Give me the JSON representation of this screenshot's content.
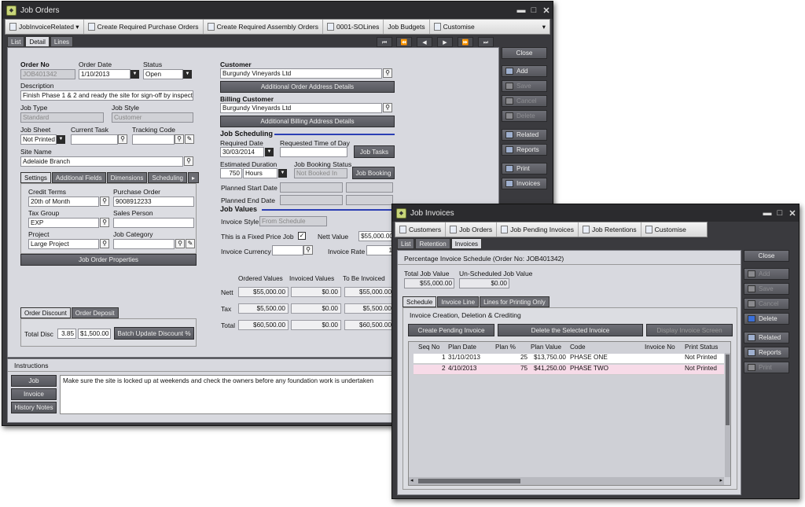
{
  "jo": {
    "title": "Job Orders",
    "toolbar": [
      "JobInvoiceRelated",
      "Create Required Purchase Orders",
      "Create Required Assembly Orders",
      "0001-SOLines",
      "Job Budgets",
      "Customise"
    ],
    "tabs": [
      "List",
      "Detail",
      "Lines"
    ],
    "nav": [
      "⏮",
      "⏪",
      "◀",
      "▶",
      "⏩",
      "⏭"
    ],
    "side": {
      "close": "Close",
      "add": "Add",
      "save": "Save",
      "cancel": "Cancel",
      "delete": "Delete",
      "related": "Related",
      "reports": "Reports",
      "print": "Print",
      "invoices": "Invoices"
    },
    "order_no_label": "Order No",
    "order_no": "JOB401342",
    "order_date_label": "Order Date",
    "order_date": "1/10/2013",
    "status_label": "Status",
    "status": "Open",
    "description_label": "Description",
    "description": "Finish Phase 1 & 2 and ready the site for sign-off by inspector",
    "job_type_label": "Job Type",
    "job_type": "Standard",
    "job_style_label": "Job Style",
    "job_style": "Customer",
    "job_sheet_label": "Job Sheet",
    "job_sheet": "Not Printed",
    "current_task_label": "Current Task",
    "tracking_code_label": "Tracking Code",
    "site_name_label": "Site Name",
    "site_name": "Adelaide Branch",
    "subtabs": [
      "Settings",
      "Additional Fields",
      "Dimensions",
      "Scheduling"
    ],
    "credit_terms_label": "Credit Terms",
    "credit_terms": "20th of Month",
    "purchase_order_label": "Purchase Order",
    "purchase_order": "9008912233",
    "tax_group_label": "Tax Group",
    "tax_group": "EXP",
    "sales_person_label": "Sales Person",
    "project_label": "Project",
    "project": "Large Project",
    "job_category_label": "Job Category",
    "job_order_properties": "Job Order Properties",
    "discount_tabs": [
      "Order Discount",
      "Order Deposit"
    ],
    "total_disc_label": "Total Disc",
    "total_disc_pct": "3.85",
    "total_disc_amt": "$1,500.00",
    "batch_update": "Batch Update Discount %",
    "instructions_label": "Instructions",
    "instr_tabs": [
      "Job",
      "Invoice",
      "History Notes"
    ],
    "instructions": "Make sure the site is locked up at weekends and check the owners before any foundation work is undertaken",
    "customer_label": "Customer",
    "customer": "Burgundy Vineyards Ltd",
    "addl_order_addr": "Additional Order Address Details",
    "billing_customer_label": "Billing Customer",
    "billing_customer": "Burgundy Vineyards Ltd",
    "addl_billing_addr": "Additional Billing Address Details",
    "job_scheduling_label": "Job Scheduling",
    "required_date_label": "Required Date",
    "required_date": "30/03/2014",
    "requested_time_label": "Requested Time of Day",
    "job_tasks": "Job Tasks",
    "est_duration_label": "Estimated Duration",
    "est_duration": "750",
    "est_unit": "Hours",
    "booking_status_label": "Job Booking Status",
    "booking_status": "Not Booked In",
    "job_booking": "Job Booking",
    "planned_start_label": "Planned Start Date",
    "planned_end_label": "Planned End Date",
    "job_values_label": "Job Values",
    "invoice_style_label": "Invoice Style",
    "invoice_style": "From Schedule",
    "fixed_price_label": "This is a Fixed Price Job",
    "nett_value_label": "Nett Value",
    "nett_value": "$55,000.00",
    "invoice_currency_label": "Invoice Currency",
    "invoice_rate_label": "Invoice Rate",
    "invoice_rate": "1",
    "values_headers": [
      "Ordered Values",
      "Invoiced Values",
      "To Be Invoiced"
    ],
    "values_rows": [
      {
        "label": "Nett",
        "cols": [
          "$55,000.00",
          "$0.00",
          "$55,000.00"
        ]
      },
      {
        "label": "Tax",
        "cols": [
          "$5,500.00",
          "$0.00",
          "$5,500.00"
        ]
      },
      {
        "label": "Total",
        "cols": [
          "$60,500.00",
          "$0.00",
          "$60,500.00"
        ]
      }
    ]
  },
  "ji": {
    "title": "Job Invoices",
    "toolbar": [
      "Customers",
      "Job Orders",
      "Job Pending Invoices",
      "Job Retentions",
      "Customise"
    ],
    "tabs": [
      "List",
      "Retention",
      "Invoices"
    ],
    "side": {
      "close": "Close",
      "add": "Add",
      "save": "Save",
      "cancel": "Cancel",
      "delete": "Delete",
      "related": "Related",
      "reports": "Reports",
      "print": "Print"
    },
    "schedule_title": "Percentage Invoice Schedule (Order No: JOB401342)",
    "total_job_value_label": "Total Job Value",
    "total_job_value": "$55,000.00",
    "unscheduled_label": "Un-Scheduled Job Value",
    "unscheduled": "$0.00",
    "subtabs": [
      "Schedule",
      "Invoice Line",
      "Lines for Printing Only"
    ],
    "section_label": "Invoice Creation, Deletion & Crediting",
    "create_pending": "Create Pending Invoice",
    "delete_selected": "Delete the Selected Invoice",
    "display_invoice": "Display Invoice Screen",
    "grid_headers": [
      "Seq No",
      "Plan Date",
      "Plan %",
      "Plan Value",
      "Code",
      "Invoice No",
      "Print Status"
    ],
    "grid_rows": [
      {
        "seq": "1",
        "date": "31/10/2013",
        "pct": "25",
        "value": "$13,750.00",
        "code": "PHASE ONE",
        "inv": "",
        "status": "Not Printed"
      },
      {
        "seq": "2",
        "date": "4/10/2013",
        "pct": "75",
        "value": "$41,250.00",
        "code": "PHASE TWO",
        "inv": "",
        "status": "Not Printed"
      }
    ]
  }
}
